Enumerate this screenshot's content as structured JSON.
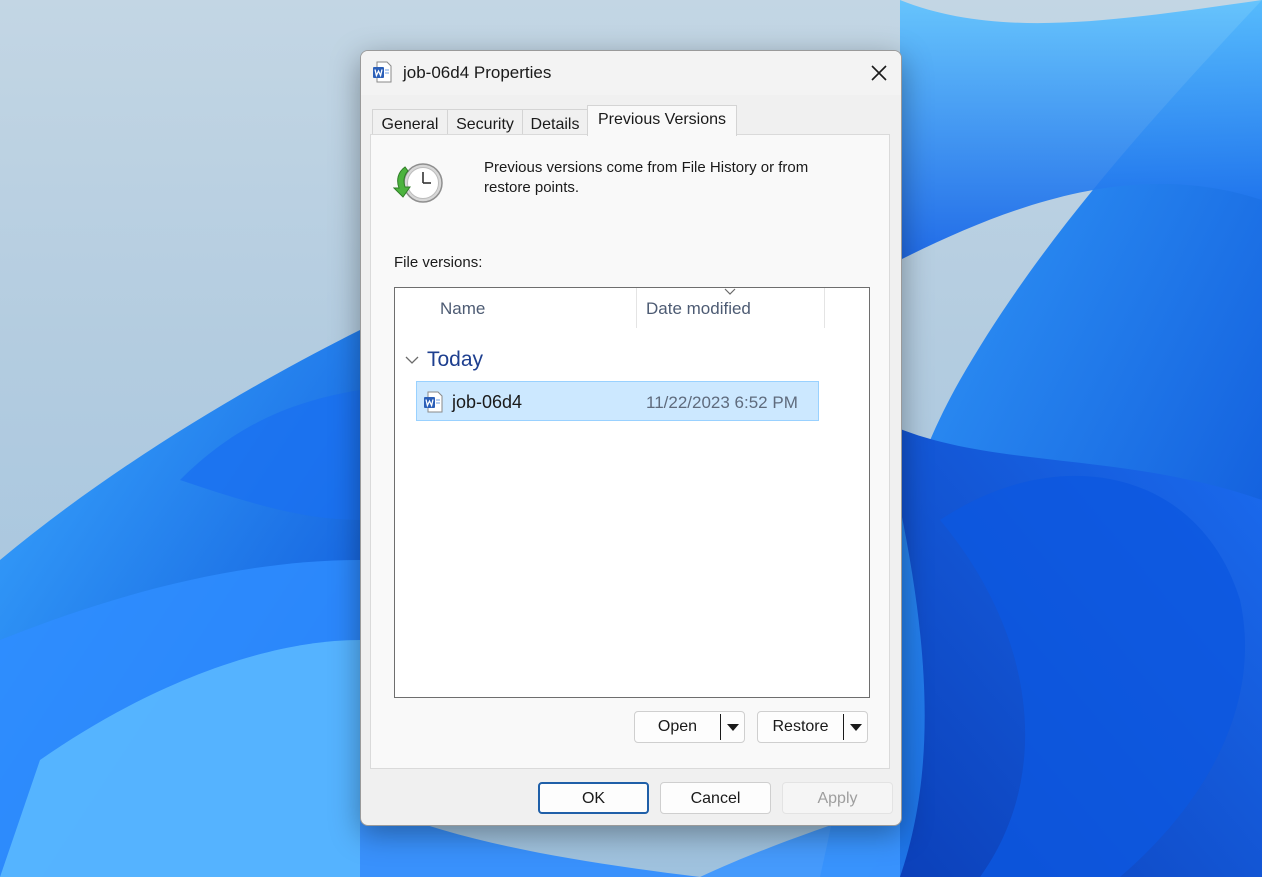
{
  "window": {
    "title": "job-06d4 Properties"
  },
  "tabs": [
    {
      "label": "General"
    },
    {
      "label": "Security"
    },
    {
      "label": "Details"
    },
    {
      "label": "Previous Versions"
    }
  ],
  "active_tab": "Previous Versions",
  "info": {
    "text": "Previous versions come from File History or from restore points."
  },
  "file_versions": {
    "label": "File versions:",
    "columns": [
      "Name",
      "Date modified"
    ],
    "sorted_column": "Date modified",
    "groups": [
      {
        "title": "Today",
        "items": [
          {
            "name": "job-06d4",
            "date_modified": "11/22/2023 6:52 PM",
            "selected": true
          }
        ]
      }
    ]
  },
  "actions": {
    "open_label": "Open",
    "restore_label": "Restore"
  },
  "buttons": {
    "ok": "OK",
    "cancel": "Cancel",
    "apply": "Apply"
  },
  "colors": {
    "selection_fill": "#cce8ff",
    "selection_border": "#99d1ff",
    "group_title": "#1e3f8f",
    "ok_border": "#1f5fa8",
    "word_blue": "#2b5fb8"
  },
  "icons": {
    "title": "word-document-icon",
    "close": "close-icon",
    "info": "clock-restore-icon",
    "row": "word-document-icon"
  }
}
